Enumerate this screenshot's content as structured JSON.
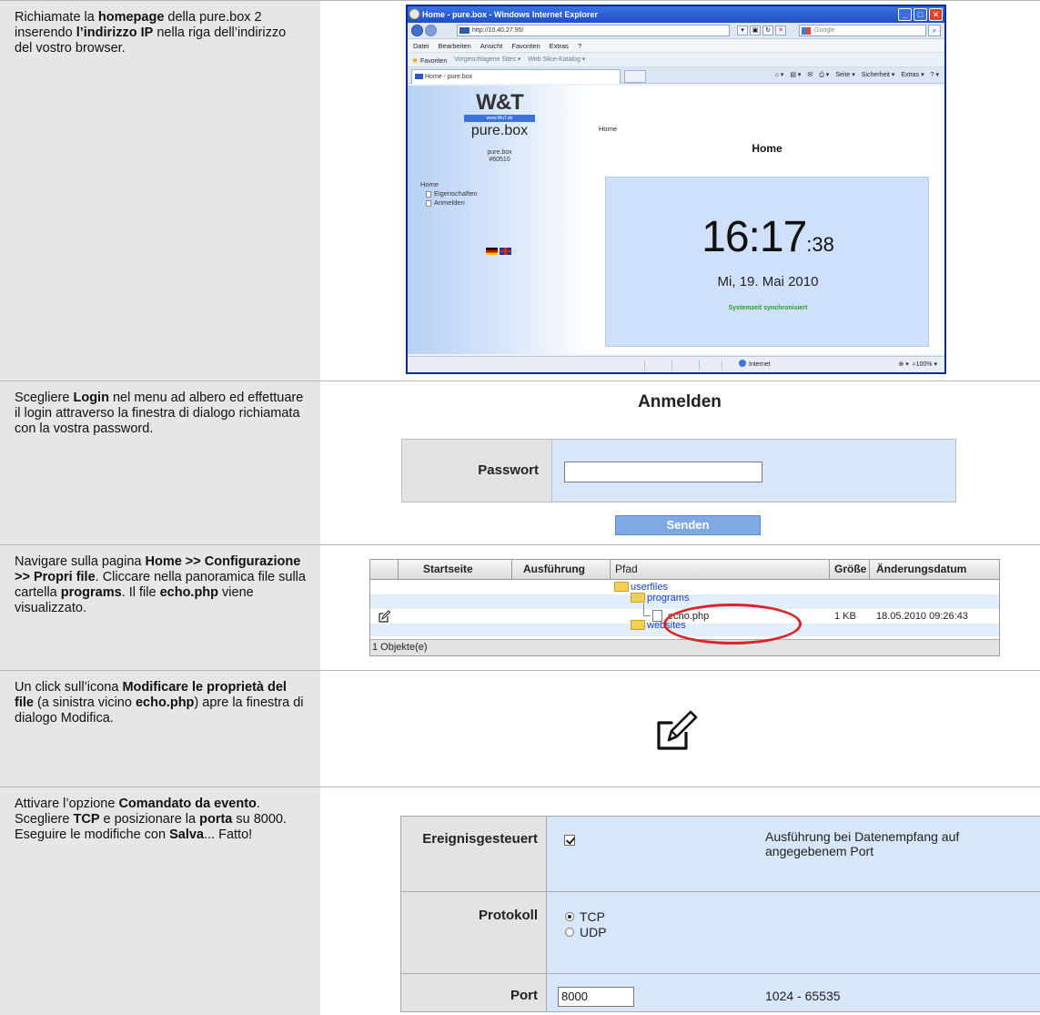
{
  "steps": {
    "s1": {
      "t1": "Richiamate la ",
      "b1": "homepage",
      "t2": " della pure.box 2 inserendo ",
      "b2": "l’indirizzo IP",
      "t3": " nella riga dell’indirizzo del vostro browser."
    },
    "s2": {
      "t1": "Scegliere ",
      "b1": "Login",
      "t2": " nel menu ad albero ed effettuare il login attraverso la finestra di dialogo richiamata con la vostra password."
    },
    "s3": {
      "t1": "Navigare sulla pagina ",
      "b1": "Home >> Configurazione >> Propri file",
      "t2": ". Cliccare nella panoramica file sulla cartella ",
      "b2": "programs",
      "t3": ". Il file ",
      "b3": "echo.php",
      "t4": " viene visualizzato."
    },
    "s4": {
      "t1": "Un click sull’icona ",
      "b1": "Modificare le proprietà del file",
      "t2": " (a sinistra vicino ",
      "b2": "echo.php",
      "t3": ") apre la finestra di dialogo Modifica."
    },
    "s5": {
      "t1": "Attivare l’opzione ",
      "b1": "Comandato da evento",
      "t2": ". Scegliere ",
      "b2": "TCP",
      "t3": " e posizionare la ",
      "b3": "porta",
      "t4": " su 8000. Eseguire le modifiche con ",
      "b4": "Salva",
      "t5": "... Fatto!"
    }
  },
  "browser": {
    "title": "Home - pure.box - Windows Internet Explorer",
    "url": "http://10.40.27.95/",
    "search_placeholder": "Google",
    "menu": [
      "Datei",
      "Bearbeiten",
      "Ansicht",
      "Favoriten",
      "Extras",
      "?"
    ],
    "favorites": "Favoriten",
    "fav_links": [
      "Vorgeschlagene Sites ▾",
      "Web Slice-Katalog ▾"
    ],
    "tab_title": "Home - pure.box",
    "commands": [
      "Seite ▾",
      "Sicherheit ▾",
      "Extras ▾"
    ],
    "status_zone": "Internet",
    "status_zoom": "100%"
  },
  "purebox": {
    "logo": "W&T",
    "logo_url": "www.WuT.de",
    "name": "pure.box",
    "model_line1": "pure.box",
    "model_line2": "#60510",
    "tree": [
      "Home",
      "Eigenschaften",
      "Anmelden"
    ],
    "breadcrumb": "Home",
    "page_title": "Home",
    "time_main": "16:17",
    "time_sec": ":38",
    "date": "Mi, 19. Mai 2010",
    "sync": "Systemzeit synchronisiert"
  },
  "login": {
    "title": "Anmelden",
    "password_label": "Passwort",
    "send_label": "Senden"
  },
  "files": {
    "columns": [
      "Startseite",
      "Ausführung",
      "Pfad",
      "Größe",
      "Änderungsdatum"
    ],
    "folder_userfiles": "userfiles",
    "folder_programs": "programs",
    "file_name": "echo.php",
    "file_size": "1 KB",
    "file_date": "18.05.2010 09:26:43",
    "folder_websites": "websites",
    "footer": "1 Objekte(e)"
  },
  "options": {
    "event_label": "Ereignisgesteuert",
    "event_checked": true,
    "event_desc": "Ausführung bei Datenempfang auf angegebenem Port",
    "protocol_label": "Protokoll",
    "protocol_tcp": "TCP",
    "protocol_udp": "UDP",
    "protocol_selected": "TCP",
    "port_label": "Port",
    "port_value": "8000",
    "port_range": "1024 - 65535"
  },
  "colors": {
    "accent_blue": "#d8e6fa",
    "link_blue": "#1a3fd6",
    "highlight_red": "#d9252a",
    "sync_green": "#2e9a2e"
  }
}
